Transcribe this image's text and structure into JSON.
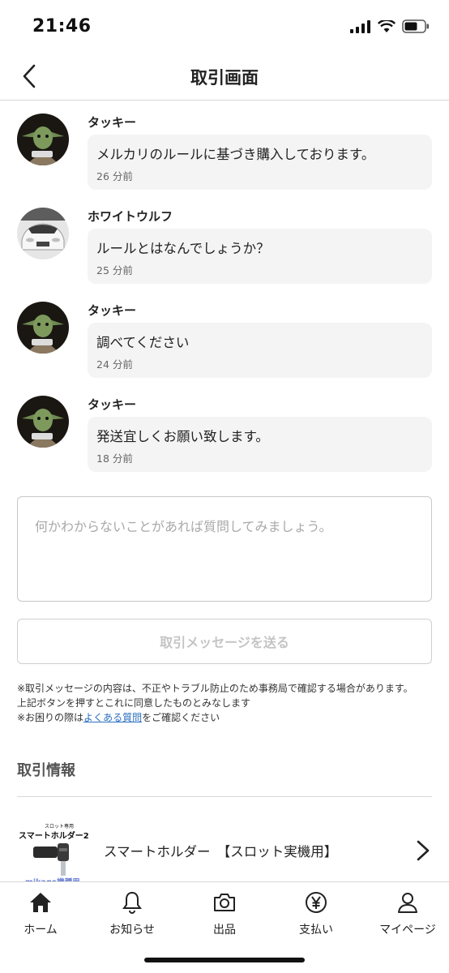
{
  "status_bar": {
    "time": "21:46"
  },
  "nav": {
    "title": "取引画面"
  },
  "messages": [
    {
      "sender": "タッキー",
      "text": "メルカリのルールに基づき購入しております。",
      "time": "26 分前",
      "avatar": "yoda-avatar"
    },
    {
      "sender": "ホワイトウルフ",
      "text": "ルールとはなんでしょうか？",
      "time": "25 分前",
      "avatar": "car-avatar"
    },
    {
      "sender": "タッキー",
      "text": "調べてください",
      "time": "24 分前",
      "avatar": "yoda-avatar"
    },
    {
      "sender": "タッキー",
      "text": "発送宜しくお願い致します。",
      "time": "18 分前",
      "avatar": "yoda-avatar"
    }
  ],
  "compose": {
    "placeholder": "何かわからないことがあれば質問してみましょう。",
    "send_label": "取引メッセージを送る"
  },
  "notes": {
    "line1": "※取引メッセージの内容は、不正やトラブル防止のため事務局で確認する場合があります。",
    "line2": "上記ボタンを押すとこれに同意したものとみなします",
    "line3_prefix": "※お困りの際は",
    "line3_link": "よくある質問",
    "line3_suffix": "をご確認ください"
  },
  "transaction_info": {
    "title": "取引情報",
    "product_name": "スマートホルダー　【スロット実機用】",
    "thumb_small": "スロット専用",
    "thumb_title": "スマートホルダー2",
    "thumb_watermark": "mikage機種用"
  },
  "tab_bar": {
    "tabs": [
      {
        "label": "ホーム",
        "icon": "home-icon"
      },
      {
        "label": "お知らせ",
        "icon": "bell-icon"
      },
      {
        "label": "出品",
        "icon": "camera-icon"
      },
      {
        "label": "支払い",
        "icon": "yen-icon"
      },
      {
        "label": "マイページ",
        "icon": "person-icon"
      }
    ]
  },
  "colors": {
    "bubble_bg": "#f4f4f4",
    "link": "#2a6fbf",
    "disabled_text": "#c4c4c4"
  }
}
